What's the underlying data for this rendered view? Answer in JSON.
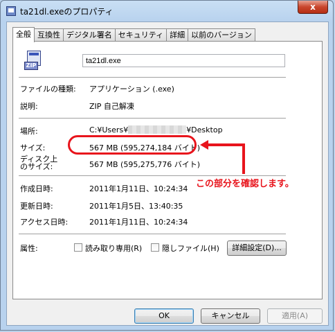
{
  "window": {
    "title": "ta21dl.exeのプロパティ",
    "close_label": "x"
  },
  "tabs": [
    {
      "label": "全般",
      "active": true
    },
    {
      "label": "互換性",
      "active": false
    },
    {
      "label": "デジタル署名",
      "active": false
    },
    {
      "label": "セキュリティ",
      "active": false
    },
    {
      "label": "詳細",
      "active": false
    },
    {
      "label": "以前のバージョン",
      "active": false
    }
  ],
  "file": {
    "icon": "zip-file-icon",
    "icon_label": "ZIP",
    "name": "ta21dl.exe"
  },
  "properties": {
    "type_label": "ファイルの種類:",
    "type_value": "アプリケーション (.exe)",
    "desc_label": "説明:",
    "desc_value": "ZIP 自己解凍",
    "location_label": "場所:",
    "location_prefix": "C:¥Users¥",
    "location_suffix": "¥Desktop",
    "size_label": "サイズ:",
    "size_value": "567 MB (595,274,184 バイト)",
    "disk_size_label_line1": "ディスク上",
    "disk_size_label_line2": "のサイズ:",
    "disk_size_value": "567 MB (595,275,776 バイト)",
    "created_label": "作成日時:",
    "created_value": "2011年1月11日、10:24:34",
    "modified_label": "更新日時:",
    "modified_value": "2011年1月5日、13:40:35",
    "accessed_label": "アクセス日時:",
    "accessed_value": "2011年1月11日、10:24:34",
    "attributes_label": "属性:",
    "readonly_label": "読み取り専用(R)",
    "readonly_checked": false,
    "hidden_label": "隠しファイル(H)",
    "hidden_checked": false,
    "advanced_button": "詳細設定(D)..."
  },
  "buttons": {
    "ok": "OK",
    "cancel": "キャンセル",
    "apply": "適用(A)"
  },
  "annotation": {
    "text": "この部分を確認します。",
    "color": "#e8141c"
  }
}
